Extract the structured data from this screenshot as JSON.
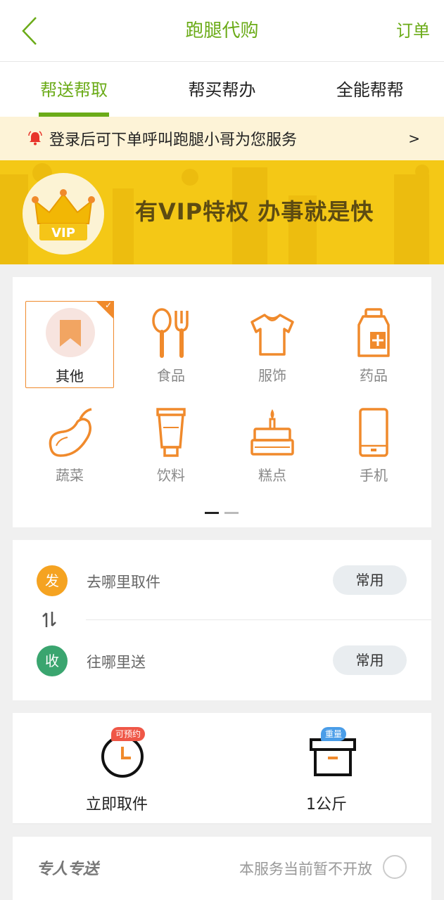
{
  "header": {
    "title": "跑腿代购",
    "orders_label": "订单"
  },
  "tabs": [
    {
      "label": "帮送帮取",
      "active": true
    },
    {
      "label": "帮买帮办",
      "active": false
    },
    {
      "label": "全能帮帮",
      "active": false
    }
  ],
  "notice": {
    "text": "登录后可下单呼叫跑腿小哥为您服务",
    "arrow": ">"
  },
  "banner": {
    "vip_badge": "VIP",
    "slogan": "有VIP特权  办事就是快"
  },
  "categories": [
    {
      "label": "其他",
      "icon": "bookmark-icon",
      "selected": true
    },
    {
      "label": "食品",
      "icon": "spoon-fork-icon",
      "selected": false
    },
    {
      "label": "服饰",
      "icon": "tshirt-icon",
      "selected": false
    },
    {
      "label": "药品",
      "icon": "medicine-bottle-icon",
      "selected": false
    },
    {
      "label": "蔬菜",
      "icon": "eggplant-icon",
      "selected": false
    },
    {
      "label": "饮料",
      "icon": "cup-icon",
      "selected": false
    },
    {
      "label": "糕点",
      "icon": "cake-icon",
      "selected": false
    },
    {
      "label": "手机",
      "icon": "phone-icon",
      "selected": false
    }
  ],
  "pager": {
    "pages": 2,
    "current": 1
  },
  "address": {
    "send_badge": "发",
    "send_placeholder": "去哪里取件",
    "recv_badge": "收",
    "recv_placeholder": "往哪里送",
    "common_label": "常用"
  },
  "options": {
    "pickup_tag": "可预约",
    "pickup_label": "立即取件",
    "weight_tag": "重量",
    "weight_label": "1公斤"
  },
  "special": {
    "title": "专人专送",
    "note": "本服务当前暂不开放"
  },
  "colors": {
    "accent_green": "#6bab18",
    "orange": "#f08a2c",
    "banner_yellow": "#f3c614",
    "notice_bg": "#fdf3d7"
  }
}
